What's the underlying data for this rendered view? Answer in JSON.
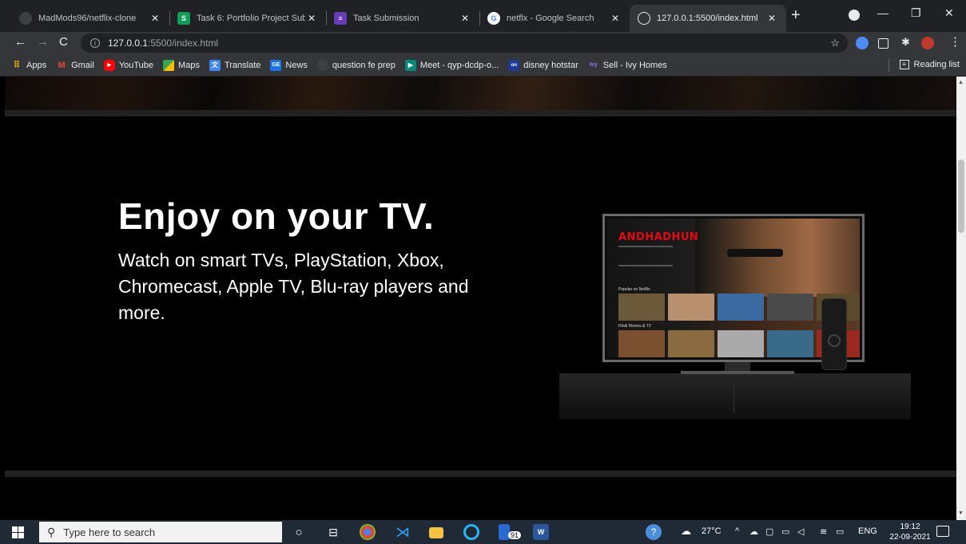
{
  "browser": {
    "tabs": [
      {
        "title": "MadMods96/netflix-clone",
        "icon": "github-icon",
        "icon_color": "#3c4043",
        "active": false
      },
      {
        "title": "Task 6: Portfolio Project Subm",
        "icon": "sheets-s-icon",
        "icon_color": "#0f9d58",
        "icon_text": "S",
        "active": false
      },
      {
        "title": "Task Submission",
        "icon": "forms-icon",
        "icon_color": "#673ab7",
        "active": false
      },
      {
        "title": "netflx - Google Search",
        "icon": "google-icon",
        "icon_color": "#ffffff",
        "active": false
      },
      {
        "title": "127.0.0.1:5500/index.html",
        "icon": "globe-icon",
        "icon_color": "#35363a",
        "active": true
      }
    ],
    "new_tab": "+",
    "window_controls": {
      "minimize": "—",
      "restore": "❐",
      "close": "✕"
    },
    "address": {
      "host": "127.0.0.1",
      "path": ":5500/index.html"
    },
    "bookmarks": [
      {
        "label": "Apps",
        "icon": "apps-grid-icon",
        "color": "#fbbc04"
      },
      {
        "label": "Gmail",
        "icon": "gmail-icon",
        "color": "#ea4335",
        "icon_text": "M"
      },
      {
        "label": "YouTube",
        "icon": "youtube-icon",
        "color": "#ff0000",
        "icon_text": "▶"
      },
      {
        "label": "Maps",
        "icon": "maps-icon",
        "color": "#34a853"
      },
      {
        "label": "Translate",
        "icon": "translate-icon",
        "color": "#4285f4"
      },
      {
        "label": "News",
        "icon": "news-icon",
        "color": "#1a73e8",
        "icon_text": "GE"
      },
      {
        "label": "question fe prep",
        "icon": "blank-page-icon",
        "color": "#35363a"
      },
      {
        "label": "Meet - qyp-dcdp-o...",
        "icon": "meet-icon",
        "color": "#00897b"
      },
      {
        "label": "disney hotstar",
        "icon": "hotstar-icon",
        "color": "#1f3a93",
        "icon_text": "on"
      },
      {
        "label": "Sell - Ivy Homes",
        "icon": "ivy-icon",
        "color": "#6b5bd6",
        "icon_text": "Ivy"
      }
    ],
    "reading_list": "Reading list"
  },
  "page": {
    "headline": "Enjoy on your TV.",
    "subtext": "Watch on smart TVs, PlayStation, Xbox, Chromecast, Apple TV, Blu-ray players and more.",
    "tv": {
      "title": "ANDHADHUN",
      "row1_label": "Popular on Netflix",
      "row2_label": "Hindi Movies & TV"
    },
    "colors": {
      "brand_red": "#e50914",
      "background": "#000000",
      "text": "#ffffff"
    }
  },
  "taskbar": {
    "search_placeholder": "Type here to search",
    "weather": "27°C",
    "language": "ENG",
    "time": "19:12",
    "date": "22-09-2021",
    "badge": "91"
  }
}
